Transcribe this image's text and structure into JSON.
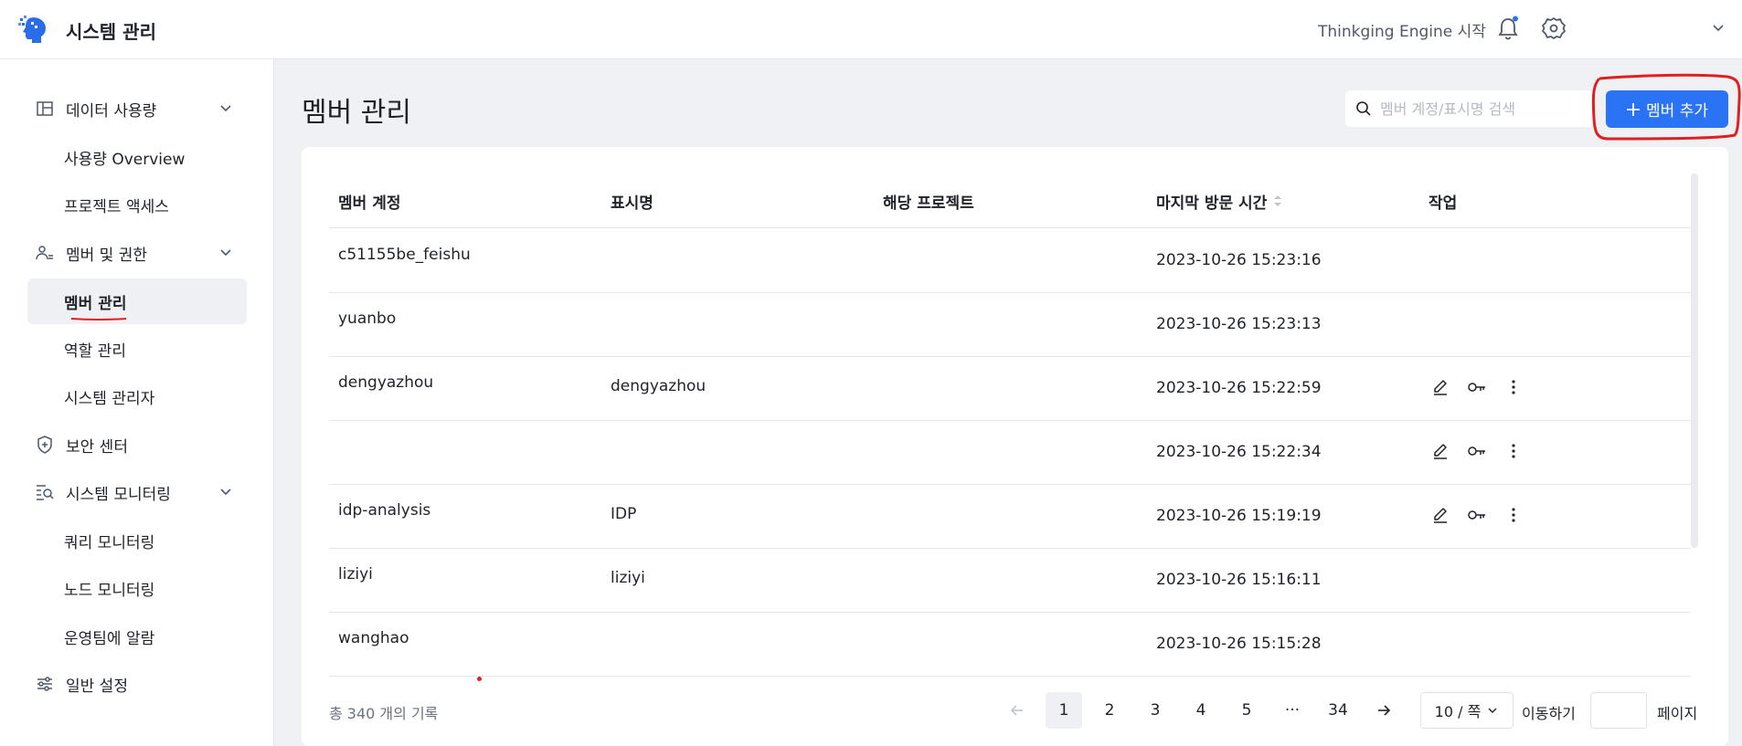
{
  "app": {
    "title": "시스템 관리"
  },
  "topbar": {
    "engine_link": "Thinkging Engine 시작"
  },
  "sidebar": {
    "items": [
      {
        "label": "데이터 사용량",
        "icon": "panel-layout-icon",
        "expandable": true
      },
      {
        "label": "사용량 Overview"
      },
      {
        "label": "프로젝트 액세스"
      },
      {
        "label": "멤버 및 권한",
        "icon": "users-icon",
        "expandable": true
      },
      {
        "label": "멤버 관리",
        "active": true
      },
      {
        "label": "역할 관리"
      },
      {
        "label": "시스템 관리자"
      },
      {
        "label": "보안 센터",
        "icon": "shield-icon"
      },
      {
        "label": "시스템 모니터링",
        "icon": "monitor-search-icon",
        "expandable": true
      },
      {
        "label": "쿼리 모니터링"
      },
      {
        "label": "노드 모니터링"
      },
      {
        "label": "운영팀에 알람"
      },
      {
        "label": "일반 설정",
        "icon": "sliders-icon"
      }
    ]
  },
  "main": {
    "title": "멤버 관리",
    "search_placeholder": "멤버 계정/표시명 검색",
    "add_button": "멤버 추가"
  },
  "table": {
    "columns": [
      "멤버 계정",
      "표시명",
      "해당 프로젝트",
      "마지막 방문 시간",
      "작업"
    ],
    "rows": [
      {
        "account": "c51155be_feishu",
        "display": "",
        "project": "",
        "last_visit": "2023-10-26 15:23:16",
        "actions": false
      },
      {
        "account": "yuanbo",
        "display": "",
        "project": "",
        "last_visit": "2023-10-26 15:23:13",
        "actions": false
      },
      {
        "account": "dengyazhou",
        "display": "dengyazhou",
        "project": "",
        "last_visit": "2023-10-26 15:22:59",
        "actions": true
      },
      {
        "account": "",
        "display": "",
        "project": "",
        "last_visit": "2023-10-26 15:22:34",
        "actions": true
      },
      {
        "account": "idp-analysis",
        "display": "IDP",
        "project": "",
        "last_visit": "2023-10-26 15:19:19",
        "actions": true
      },
      {
        "account": "liziyi",
        "display": "liziyi",
        "project": "",
        "last_visit": "2023-10-26 15:16:11",
        "actions": false
      },
      {
        "account": "wanghao",
        "display": "",
        "project": "",
        "last_visit": "2023-10-26 15:15:28",
        "actions": false
      }
    ]
  },
  "pagination": {
    "total_text": "총 340 개의 기록",
    "pages": [
      "1",
      "2",
      "3",
      "4",
      "5",
      "···",
      "34"
    ],
    "current": "1",
    "page_size": "10 / 쪽",
    "goto_label": "이동하기",
    "page_label": "페이지"
  },
  "colors": {
    "primary": "#2b73f5",
    "annotation": "#e02020"
  }
}
